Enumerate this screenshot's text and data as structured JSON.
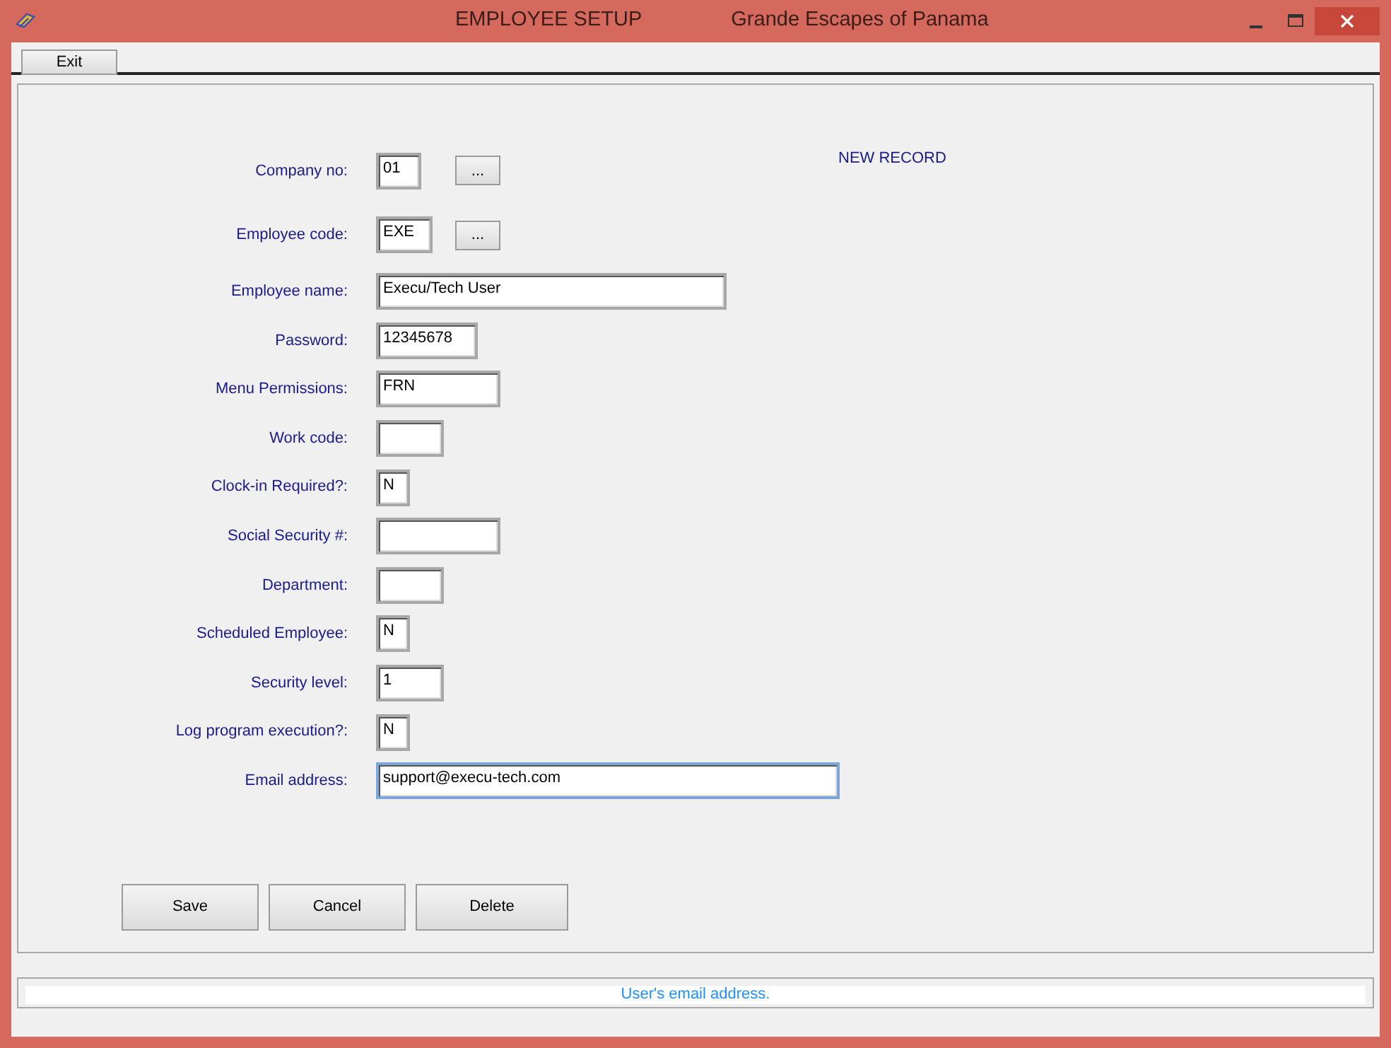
{
  "window": {
    "title": "EMPLOYEE SETUP",
    "subtitle": "Grande Escapes of Panama"
  },
  "toolbar": {
    "buttons": [
      "Exit"
    ]
  },
  "record_status": "NEW RECORD",
  "fields": [
    {
      "label": "Company no:",
      "value": "01",
      "lookup_button": "...",
      "focused": false
    },
    {
      "label": "Employee code:",
      "value": "EXE",
      "lookup_button": "...",
      "focused": false
    },
    {
      "label": "Employee name:",
      "value": "Execu/Tech User",
      "focused": false
    },
    {
      "label": "Password:",
      "value": "12345678",
      "focused": false
    },
    {
      "label": "Menu Permissions:",
      "value": "FRN",
      "focused": false
    },
    {
      "label": "Work code:",
      "focused": false
    },
    {
      "label": "Clock-in Required?:",
      "value": "N",
      "focused": false
    },
    {
      "label": "Social Security #:",
      "focused": false
    },
    {
      "label": "Department:",
      "focused": false
    },
    {
      "label": "Scheduled Employee:",
      "value": "N",
      "focused": false
    },
    {
      "label": "Security level:",
      "value": "1",
      "focused": false
    },
    {
      "label": "Log program execution?:",
      "value": "N",
      "focused": false
    },
    {
      "label": "Email address:",
      "value": "support@execu-tech.com",
      "focused": true
    }
  ],
  "actions": [
    "Save",
    "Cancel",
    "Delete"
  ],
  "status_bar": "User's email address."
}
